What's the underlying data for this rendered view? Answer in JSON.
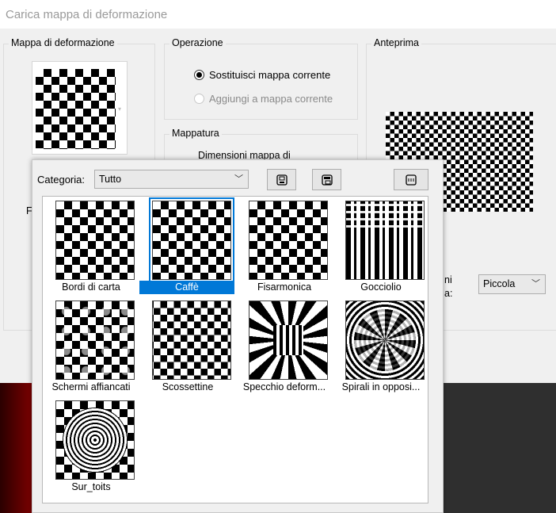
{
  "window": {
    "title": "Carica mappa di deformazione"
  },
  "map_group": {
    "legend": "Mappa di deformazione",
    "partial_label": "F"
  },
  "operation": {
    "legend": "Operazione",
    "options": [
      {
        "label": "Sostituisci mappa corrente",
        "selected": true,
        "enabled": true
      },
      {
        "label": "Aggiungi a mappa corrente",
        "selected": false,
        "enabled": false
      }
    ]
  },
  "mapping": {
    "legend": "Mappatura",
    "dimension_label": "Dimensioni mappa di"
  },
  "preview": {
    "legend": "Anteprima",
    "size_label_partial_1": "ni",
    "size_label_partial_2": "a:",
    "size_value": "Piccola"
  },
  "picker": {
    "category_label": "Categoria:",
    "category_value": "Tutto",
    "items": [
      {
        "label": "Bordi di carta",
        "icon": "checker-paper-edges"
      },
      {
        "label": "Caffè",
        "icon": "checker-coffee",
        "selected": true
      },
      {
        "label": "Fisarmonica",
        "icon": "checker-accordion"
      },
      {
        "label": "Gocciolio",
        "icon": "checker-drip"
      },
      {
        "label": "Schermi affiancati",
        "icon": "checker-tiled-screens"
      },
      {
        "label": "Scossettine",
        "icon": "checker-jitter"
      },
      {
        "label": "Specchio deform...",
        "icon": "checker-funhouse-mirror"
      },
      {
        "label": "Spirali in opposi...",
        "icon": "checker-opposite-spirals"
      },
      {
        "label": "Sur_toits",
        "icon": "checker-rooftops"
      }
    ]
  },
  "colors": {
    "accent": "#0078d7",
    "background": "#f0f0f0"
  }
}
